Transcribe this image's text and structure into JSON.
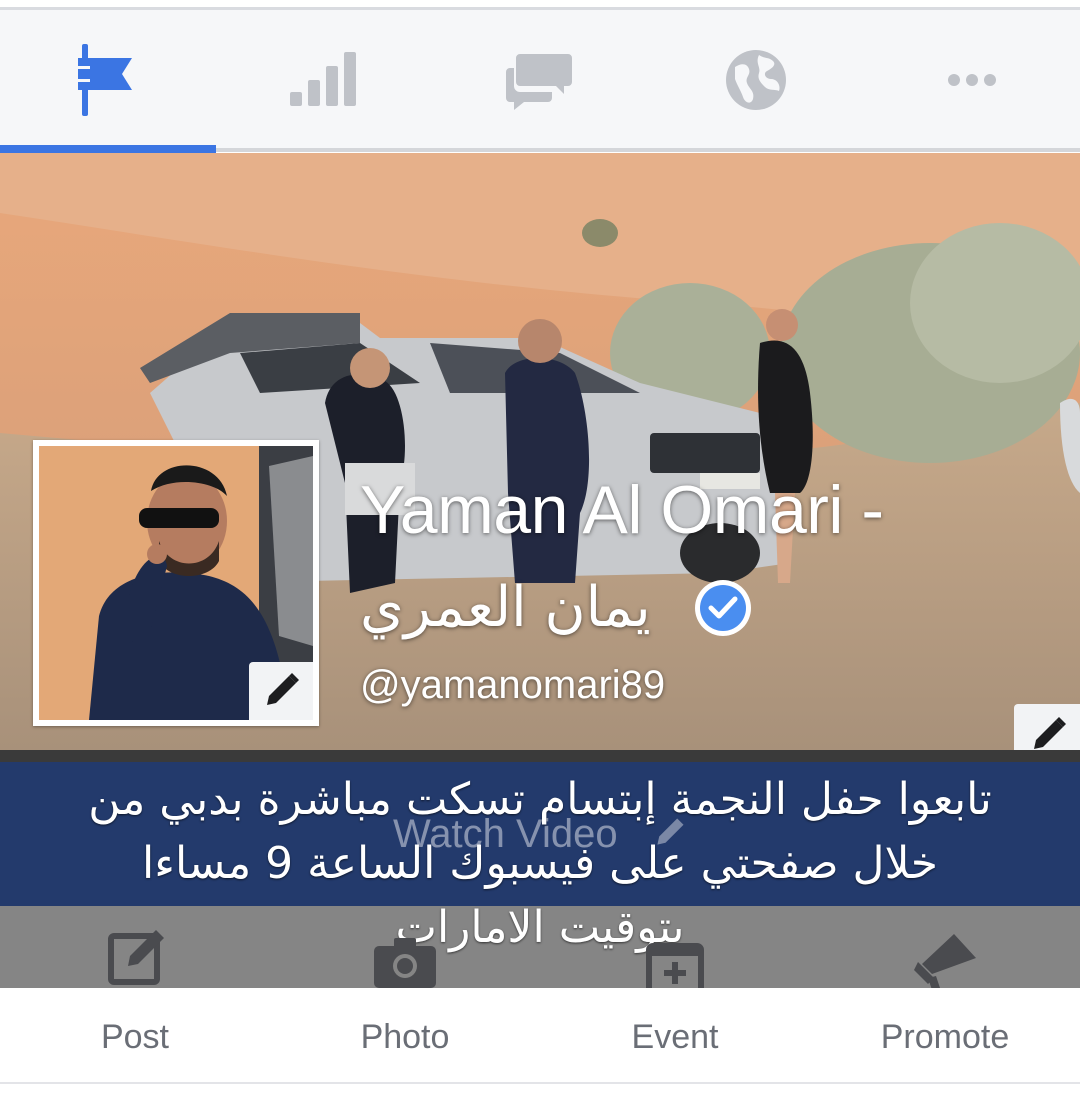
{
  "tabs": [
    {
      "icon": "flag-icon",
      "active": true
    },
    {
      "icon": "bar-chart-icon",
      "active": false
    },
    {
      "icon": "chat-bubbles-icon",
      "active": false
    },
    {
      "icon": "globe-icon",
      "active": false
    },
    {
      "icon": "more-dots-icon",
      "active": false
    }
  ],
  "profile": {
    "name": "Yaman Al Omari -",
    "name_ar": "يمان العمري",
    "handle": "@yamanomari89",
    "verified": true
  },
  "cover": {
    "watch_video_label": "Watch Video"
  },
  "caption": {
    "lines": [
      "تابعوا حفل النجمة إبتسام تسكت مباشرة بدبي من",
      "خلال صفحتي على فيسبوك الساعة 9 مساءا",
      "بتوقيت الامارات"
    ]
  },
  "actions": [
    {
      "label": "Post",
      "icon": "compose-icon"
    },
    {
      "label": "Photo",
      "icon": "camera-icon"
    },
    {
      "label": "Event",
      "icon": "calendar-plus-icon"
    },
    {
      "label": "Promote",
      "icon": "megaphone-icon"
    }
  ],
  "colors": {
    "accent": "#3b75e3",
    "icon_inactive": "#bfc2c8",
    "banner": "#233a6c",
    "verified": "#4a8ef0"
  }
}
